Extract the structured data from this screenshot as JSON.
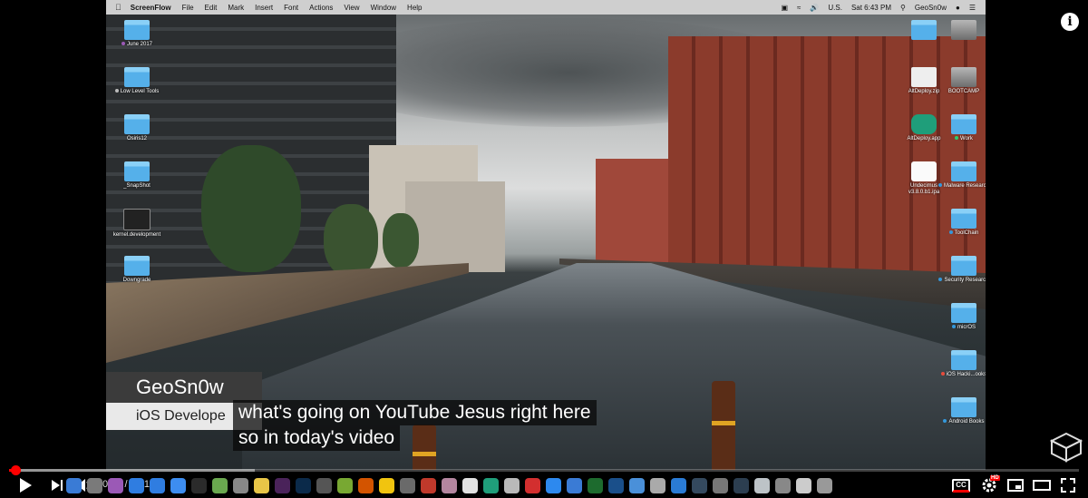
{
  "menubar": {
    "app_name": "ScreenFlow",
    "items": [
      "File",
      "Edit",
      "Mark",
      "Insert",
      "Font",
      "Actions",
      "View",
      "Window",
      "Help"
    ],
    "input_source": "U.S.",
    "clock": "Sat 6:43 PM",
    "user": "GeoSn0w"
  },
  "desktop_left": [
    {
      "label": "June 2017",
      "kind": "folder",
      "tag": "#9b59b6"
    },
    {
      "label": "Low Level Tools",
      "kind": "folder",
      "tag": "#bbbbbb"
    },
    {
      "label": "Osiris12",
      "kind": "folder",
      "tag": ""
    },
    {
      "label": "_SnapShot",
      "kind": "folder",
      "tag": ""
    },
    {
      "label": "kernel.development",
      "kind": "term",
      "tag": ""
    },
    {
      "label": "Downgrade",
      "kind": "folder",
      "tag": ""
    }
  ],
  "desktop_right_col1": [
    {
      "label": "",
      "kind": "folder",
      "tag": ""
    },
    {
      "label": "AltDeploy.zip",
      "kind": "zip",
      "tag": ""
    },
    {
      "label": "AltDeploy.app",
      "kind": "app",
      "tag": ""
    },
    {
      "label": "Undecimus v3.8.0.b1.ipa",
      "kind": "ipa",
      "tag": ""
    }
  ],
  "desktop_right_col2": [
    {
      "label": "",
      "kind": "disk",
      "tag": ""
    },
    {
      "label": "BOOTCAMP",
      "kind": "disk",
      "tag": ""
    },
    {
      "label": "Work",
      "kind": "folder",
      "tag": "#2ecc71"
    },
    {
      "label": "Malware Research",
      "kind": "folder",
      "tag": "#3498db"
    },
    {
      "label": "ToolChain",
      "kind": "folder",
      "tag": "#3498db"
    },
    {
      "label": "Security Research",
      "kind": "folder",
      "tag": "#3498db"
    },
    {
      "label": "micrOS",
      "kind": "folder",
      "tag": "#3498db"
    },
    {
      "label": "iOS Hacki...ooks",
      "kind": "folder",
      "tag": "#e74c3c"
    },
    {
      "label": "Android Books",
      "kind": "folder",
      "tag": "#3498db"
    }
  ],
  "lower_third": {
    "name": "GeoSn0w",
    "role": "iOS Develope"
  },
  "captions": {
    "line1": "what's going on YouTube Jesus right here",
    "line2": "so in today's video"
  },
  "player": {
    "time_current": "0:02",
    "time_total": "5:31",
    "played_fraction": 0.006,
    "buffered_fraction": 0.23,
    "settings_badge": "HD",
    "info_glyph": "i"
  },
  "dock_colors": [
    "#3a7bd5",
    "#7a7a7a",
    "#9b59b6",
    "#2f7de1",
    "#2f7de1",
    "#3d8df0",
    "#2b2b2b",
    "#6aa84f",
    "#888888",
    "#e8c547",
    "#4a235a",
    "#0b2a4a",
    "#555555",
    "#78a832",
    "#d35400",
    "#f1c40f",
    "#6a6a6a",
    "#c0392b",
    "#b4869f",
    "#e1e1e1",
    "#1f9e7a",
    "#b9b9b9",
    "#d32f2f",
    "#2d89ef",
    "#3a7bd5",
    "#1d6b2e",
    "#1a4f8a",
    "#4a90d9",
    "#aaaaaa",
    "#2a7bd5",
    "#34495e",
    "#777777",
    "#2c3e50",
    "#bdc3c7",
    "#888888",
    "#cccccc",
    "#999999"
  ],
  "colors": {
    "accent": "#ff0000",
    "caption_bg": "#080808"
  }
}
